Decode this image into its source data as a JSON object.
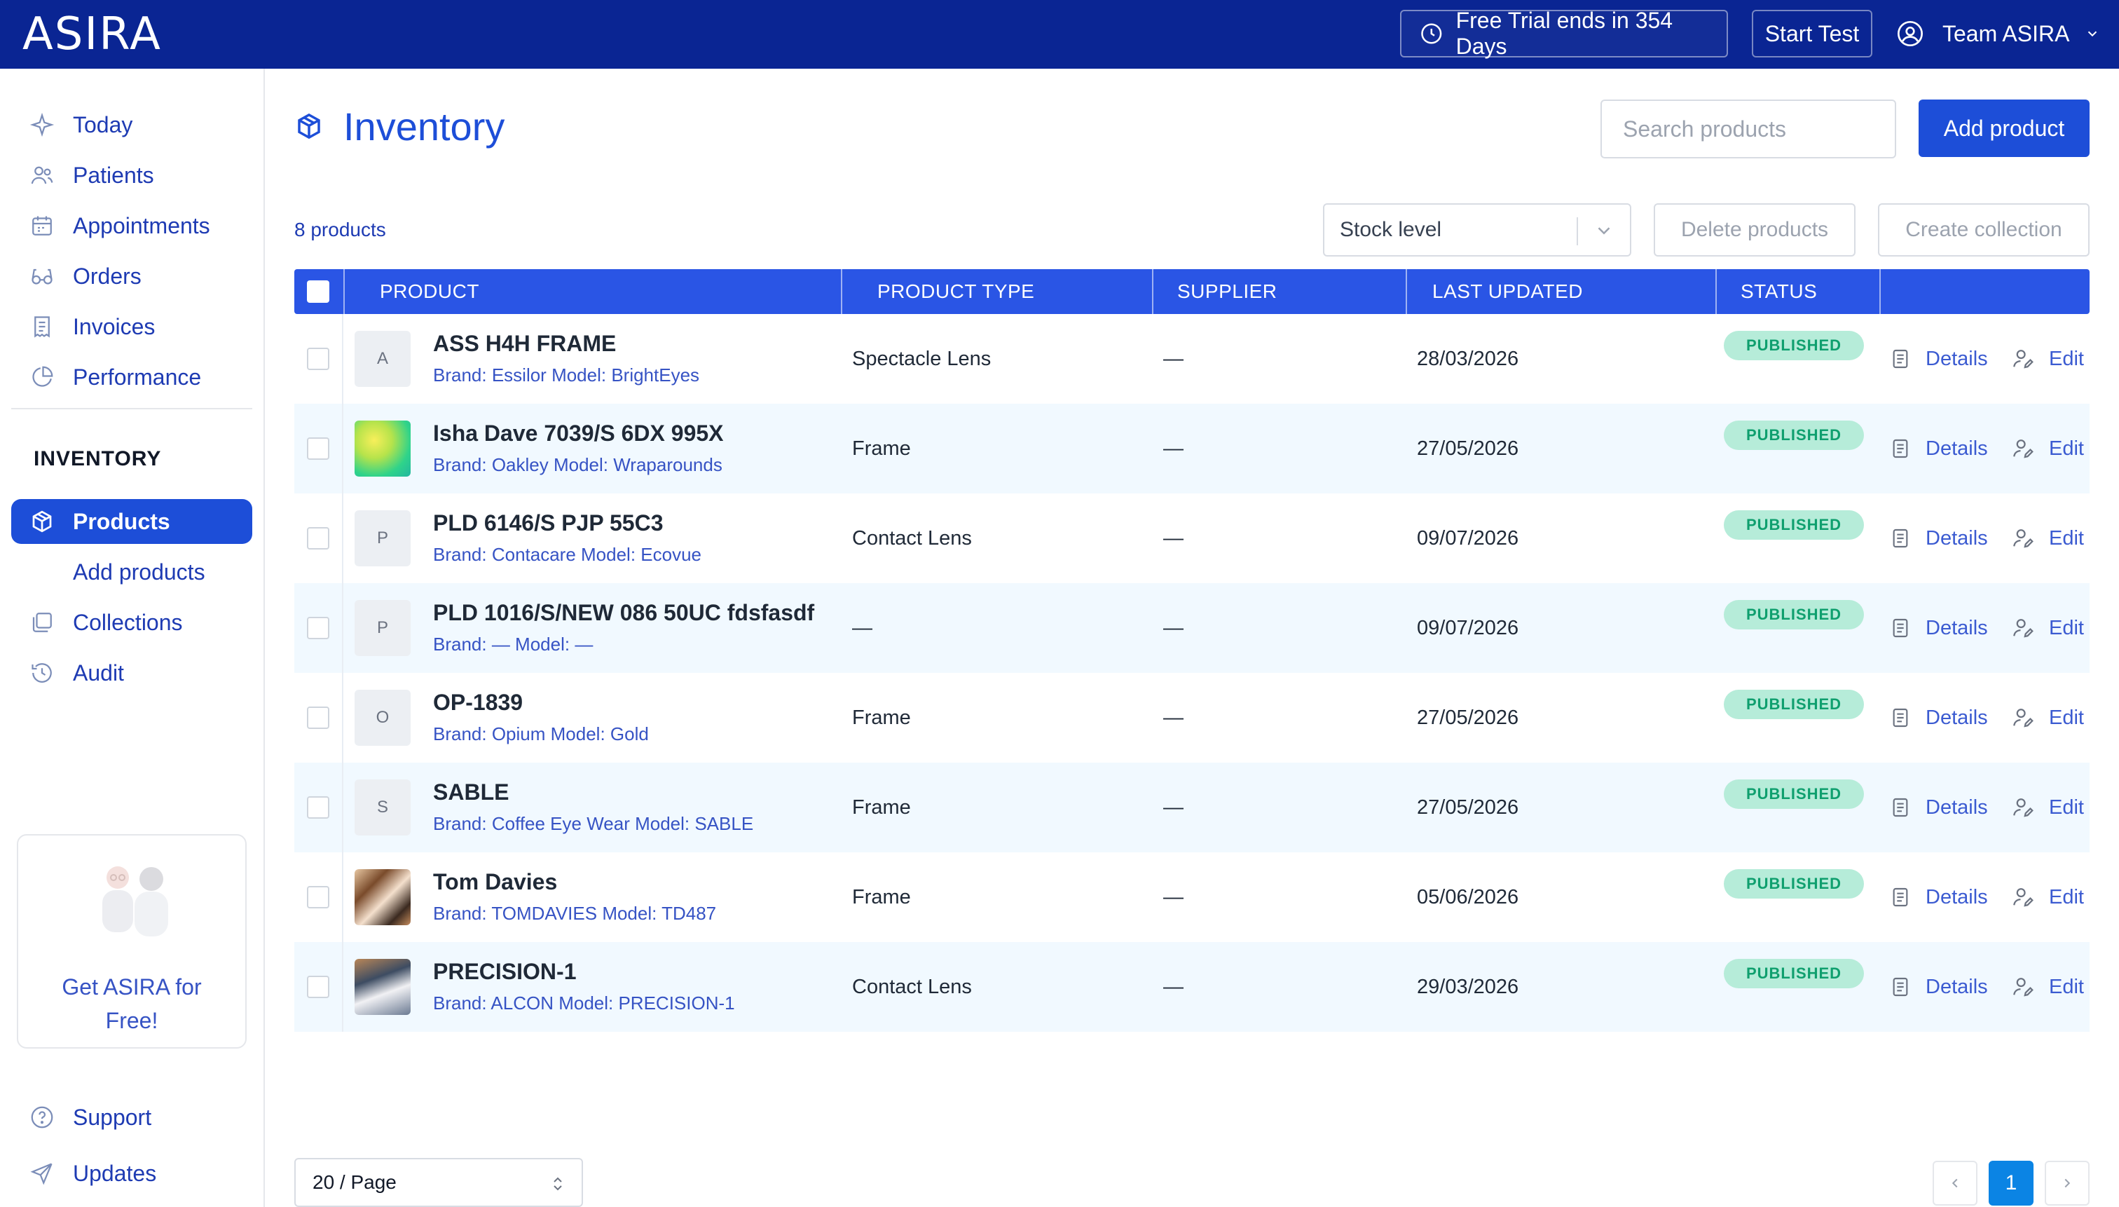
{
  "brand": {
    "logo": "ASIRA",
    "bar_color": "#0a2593",
    "accent": "#1d4ed8"
  },
  "header": {
    "trial_label": "Free Trial ends in 354 Days",
    "trial_icon": "clock-icon",
    "start_test": "Start Test",
    "team_label": "Team ASIRA",
    "team_icon": "user-circle-icon"
  },
  "sidebar": {
    "main_items": [
      {
        "label": "Today",
        "icon": "sparkle-icon"
      },
      {
        "label": "Patients",
        "icon": "users-icon"
      },
      {
        "label": "Appointments",
        "icon": "calendar-icon"
      },
      {
        "label": "Orders",
        "icon": "glasses-icon"
      },
      {
        "label": "Invoices",
        "icon": "receipt-icon"
      },
      {
        "label": "Performance",
        "icon": "pie-chart-icon"
      }
    ],
    "section_title": "INVENTORY",
    "inventory_items": [
      {
        "label": "Products",
        "icon": "cube-icon",
        "active": true
      },
      {
        "label": "Add products",
        "icon": "",
        "active": false
      },
      {
        "label": "Collections",
        "icon": "collections-icon",
        "active": false
      },
      {
        "label": "Audit",
        "icon": "history-icon",
        "active": false
      }
    ],
    "promo_text": "Get ASIRA for Free!",
    "bottom_items": [
      {
        "label": "Support",
        "icon": "help-circle-icon"
      },
      {
        "label": "Updates",
        "icon": "send-icon"
      }
    ]
  },
  "main": {
    "title": "Inventory",
    "title_icon": "cube-icon",
    "search_placeholder": "Search products",
    "add_button": "Add product",
    "count": "8 products",
    "stock_filter": "Stock level",
    "delete_button": "Delete products",
    "collection_button": "Create collection"
  },
  "table": {
    "headers": {
      "product": "PRODUCT",
      "type": "PRODUCT TYPE",
      "supplier": "SUPPLIER",
      "updated": "LAST UPDATED",
      "status": "STATUS"
    },
    "rows": [
      {
        "name": "ASS H4H FRAME",
        "meta": "Brand: Essilor Model: BrightEyes",
        "thumb": "A",
        "type": "Spectacle Lens",
        "supplier": "—",
        "updated": "28/03/2026",
        "status": "PUBLISHED",
        "details": "Details",
        "edit": "Edit"
      },
      {
        "name": "Isha Dave 7039/S 6DX 995X",
        "meta": "Brand: Oakley Model: Wraparounds",
        "thumb": "",
        "type": "Frame",
        "supplier": "—",
        "updated": "27/05/2026",
        "status": "PUBLISHED",
        "details": "Details",
        "edit": "Edit"
      },
      {
        "name": "PLD 6146/S PJP 55C3",
        "meta": "Brand: Contacare Model: Ecovue",
        "thumb": "P",
        "type": "Contact Lens",
        "supplier": "—",
        "updated": "09/07/2026",
        "status": "PUBLISHED",
        "details": "Details",
        "edit": "Edit"
      },
      {
        "name": "PLD 1016/S/NEW 086 50UC fdsfasdf",
        "meta": "Brand: — Model: —",
        "thumb": "P",
        "type": "—",
        "supplier": "—",
        "updated": "09/07/2026",
        "status": "PUBLISHED",
        "details": "Details",
        "edit": "Edit"
      },
      {
        "name": "OP-1839",
        "meta": "Brand: Opium Model: Gold",
        "thumb": "O",
        "type": "Frame",
        "supplier": "—",
        "updated": "27/05/2026",
        "status": "PUBLISHED",
        "details": "Details",
        "edit": "Edit"
      },
      {
        "name": "SABLE",
        "meta": "Brand: Coffee Eye Wear Model: SABLE",
        "thumb": "S",
        "type": "Frame",
        "supplier": "—",
        "updated": "27/05/2026",
        "status": "PUBLISHED",
        "details": "Details",
        "edit": "Edit"
      },
      {
        "name": "Tom Davies",
        "meta": "Brand: TOMDAVIES Model: TD487",
        "thumb": "",
        "type": "Frame",
        "supplier": "—",
        "updated": "05/06/2026",
        "status": "PUBLISHED",
        "details": "Details",
        "edit": "Edit"
      },
      {
        "name": "PRECISION-1",
        "meta": "Brand: ALCON Model: PRECISION-1",
        "thumb": "",
        "type": "Contact Lens",
        "supplier": "—",
        "updated": "29/03/2026",
        "status": "PUBLISHED",
        "details": "Details",
        "edit": "Edit"
      }
    ]
  },
  "footer": {
    "page_size": "20 / Page",
    "current_page": "1"
  }
}
